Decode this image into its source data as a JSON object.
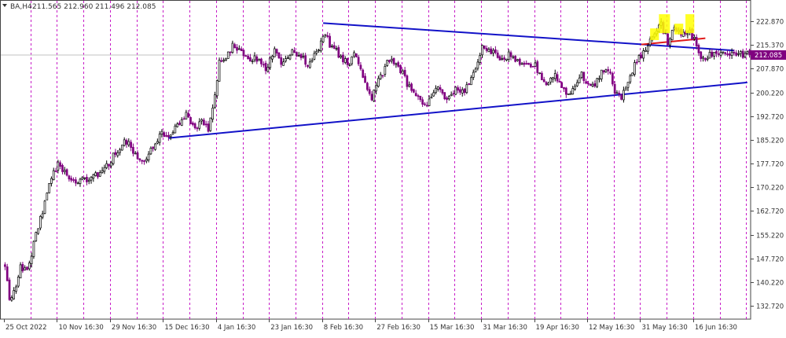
{
  "header": {
    "symbol": "BA,H4",
    "quote": "211.565 212.960 211.496 212.085"
  },
  "colors": {
    "bull": "#000000",
    "bear": "#800080",
    "grid": "#c71cc7",
    "trendline": "#1212c8",
    "neckline": "#e01a1a",
    "highlight": "#ffff00",
    "price_box": "#800080",
    "axis_text": "#333333"
  },
  "chart_data": {
    "type": "candlestick",
    "symbol": "BA",
    "timeframe": "H4",
    "ylim": [
      128.5,
      228.5
    ],
    "y_ticks": [
      132.72,
      140.22,
      147.72,
      155.22,
      162.72,
      170.22,
      177.72,
      185.22,
      192.72,
      200.22,
      207.87,
      215.37,
      222.87
    ],
    "y_tick_labels": [
      "132.720",
      "140.220",
      "147.720",
      "155.220",
      "162.720",
      "170.220",
      "177.720",
      "185.220",
      "192.720",
      "200.220",
      "207.870",
      "215.370",
      "222.870"
    ],
    "x_labels": [
      "25 Oct 2022",
      "10 Nov 16:30",
      "29 Nov 16:30",
      "15 Dec 16:30",
      "4 Jan 16:30",
      "23 Jan 16:30",
      "8 Feb 16:30",
      "27 Feb 16:30",
      "15 Mar 16:30",
      "31 Mar 16:30",
      "19 Apr 16:30",
      "12 May 16:30",
      "31 May 16:30",
      "16 Jun 16:30"
    ],
    "x_label_bar_index": [
      0,
      24,
      48,
      72,
      96,
      120,
      144,
      168,
      192,
      216,
      240,
      264,
      288,
      312
    ],
    "bar_count": 338,
    "current_price": 212.085,
    "current_price_label": "212.085",
    "price_path": [
      [
        0,
        146
      ],
      [
        2,
        134
      ],
      [
        4,
        137
      ],
      [
        7,
        145
      ],
      [
        10,
        143
      ],
      [
        14,
        156
      ],
      [
        17,
        163
      ],
      [
        20,
        172
      ],
      [
        24,
        178
      ],
      [
        28,
        174
      ],
      [
        33,
        172
      ],
      [
        38,
        173
      ],
      [
        43,
        175
      ],
      [
        47,
        178
      ],
      [
        51,
        182
      ],
      [
        55,
        185
      ],
      [
        59,
        181
      ],
      [
        63,
        178
      ],
      [
        67,
        183
      ],
      [
        71,
        187
      ],
      [
        74,
        185
      ],
      [
        78,
        190
      ],
      [
        82,
        194
      ],
      [
        85,
        189
      ],
      [
        89,
        191
      ],
      [
        92,
        188
      ],
      [
        94,
        195
      ],
      [
        97,
        210
      ],
      [
        100,
        212
      ],
      [
        103,
        215
      ],
      [
        106,
        213
      ],
      [
        110,
        210
      ],
      [
        114,
        211
      ],
      [
        118,
        208
      ],
      [
        122,
        213
      ],
      [
        126,
        209
      ],
      [
        130,
        214
      ],
      [
        134,
        211
      ],
      [
        138,
        209
      ],
      [
        142,
        214
      ],
      [
        145,
        219
      ],
      [
        148,
        214
      ],
      [
        152,
        212
      ],
      [
        155,
        209
      ],
      [
        158,
        212
      ],
      [
        160,
        210
      ],
      [
        163,
        203
      ],
      [
        166,
        199
      ],
      [
        170,
        205
      ],
      [
        174,
        211
      ],
      [
        178,
        209
      ],
      [
        182,
        203
      ],
      [
        186,
        199
      ],
      [
        190,
        196
      ],
      [
        193,
        199
      ],
      [
        196,
        203
      ],
      [
        200,
        197
      ],
      [
        204,
        202
      ],
      [
        208,
        200
      ],
      [
        212,
        207
      ],
      [
        216,
        214
      ],
      [
        220,
        213
      ],
      [
        224,
        211
      ],
      [
        228,
        212
      ],
      [
        232,
        210
      ],
      [
        236,
        209
      ],
      [
        240,
        209
      ],
      [
        243,
        205
      ],
      [
        246,
        203
      ],
      [
        249,
        206
      ],
      [
        252,
        201
      ],
      [
        255,
        199
      ],
      [
        258,
        203
      ],
      [
        261,
        206
      ],
      [
        264,
        202
      ],
      [
        267,
        202
      ],
      [
        270,
        207
      ],
      [
        273,
        208
      ],
      [
        276,
        200
      ],
      [
        279,
        199
      ],
      [
        282,
        203
      ],
      [
        285,
        209
      ],
      [
        288,
        212
      ],
      [
        291,
        216
      ],
      [
        294,
        218
      ],
      [
        297,
        222
      ],
      [
        300,
        216
      ],
      [
        303,
        221
      ],
      [
        306,
        218
      ],
      [
        309,
        220
      ],
      [
        312,
        217
      ],
      [
        315,
        212
      ],
      [
        317,
        211.5
      ],
      [
        318,
        212.085
      ]
    ],
    "channel_upper": {
      "start": [
        144,
        222.2
      ],
      "end": [
        330,
        213.5
      ]
    },
    "channel_lower": {
      "start": [
        74,
        185.8
      ],
      "end": [
        336,
        203.4
      ]
    },
    "neckline": {
      "start": [
        288,
        215.4
      ],
      "end": [
        317,
        217.4
      ]
    },
    "highlight_boxes": [
      {
        "from_bar": 292,
        "to_bar": 296,
        "low": 216.8,
        "high": 220.5
      },
      {
        "from_bar": 296,
        "to_bar": 301,
        "low": 219.0,
        "high": 225.0
      },
      {
        "from_bar": 303,
        "to_bar": 307,
        "low": 218.6,
        "high": 222.0
      },
      {
        "from_bar": 308,
        "to_bar": 312,
        "low": 219.0,
        "high": 225.0
      }
    ]
  }
}
